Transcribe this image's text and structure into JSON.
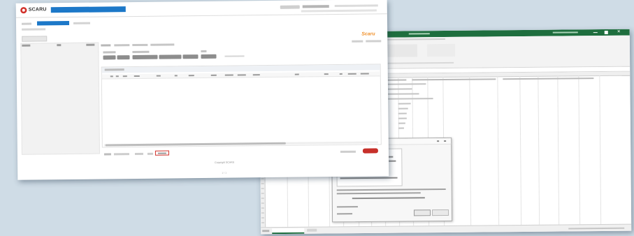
{
  "colors": {
    "brand_red": "#d1312a",
    "scaru_blue": "#1c78c8",
    "excel_green": "#1e6e3e",
    "pill_gray": "#8d8d8d"
  },
  "scaru": {
    "logo_text": "SCARU",
    "logo_orange_text": "Scaru",
    "footer_text": "Copyright SCARU",
    "footer_page": "1 / 1"
  },
  "excel": {
    "ribbon_icon": "excel-ribbon-icons",
    "close_x": "✕"
  }
}
